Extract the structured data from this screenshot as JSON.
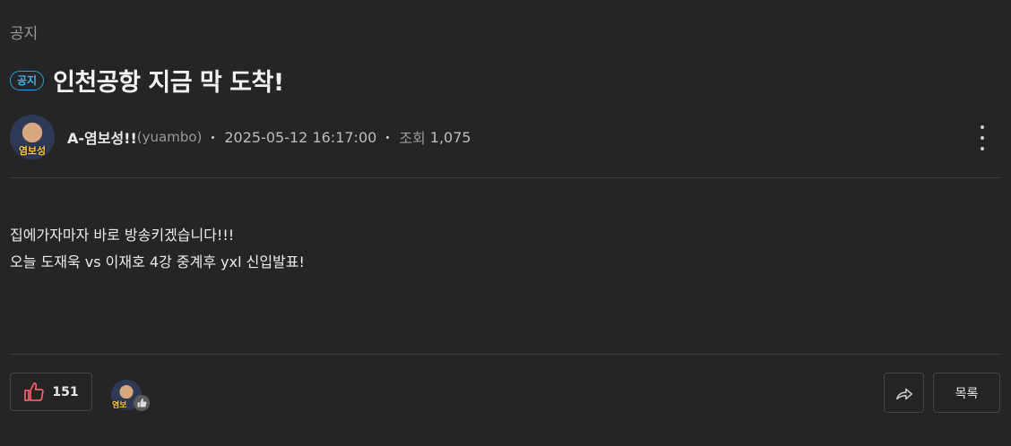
{
  "post": {
    "category": "공지",
    "badge": "공지",
    "title": "인천공항 지금 막 도착!",
    "author": "A-염보성!!",
    "author_id": "(yuambo)",
    "avatar_text": "염보성",
    "date": "2025-05-12 16:17:00",
    "views_label": "조회",
    "views": "1,075",
    "content_lines": [
      "집에가자마자 바로 방송키겠습니다!!!",
      "오늘 도재욱 vs 이재호 4강 중계후 yxl 신입발표!"
    ]
  },
  "footer": {
    "like_count": "151",
    "liker_avatar_text": "염보",
    "list_label": "목록"
  },
  "colors": {
    "background": "#252525",
    "badge_accent": "#2a9fd6",
    "like_icon": "#ff5a6e"
  },
  "icons": {
    "like": "thumbs-up-icon",
    "share": "share-arrow-icon",
    "more": "more-vertical-icon"
  }
}
